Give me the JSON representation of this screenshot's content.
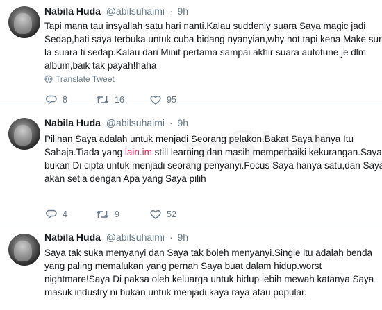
{
  "tweets": [
    {
      "name": "Nabila Huda",
      "handle": "@abilsuhaimi",
      "time": "9h",
      "lines": [
        "Tapi mana tau insyallah satu hari nanti.Kalau suddenly suara Saya magic jadi",
        "Sedap,hati saya terbuka untuk cuba bidang nyanyian,why not.tapi kena Make sure",
        "la suara ti sedap.Kalau dari Minit pertama sampai akhir suara autotune je dlm",
        "album,baik tak payah!haha"
      ],
      "translate": "Translate Tweet",
      "replies": "8",
      "retweets": "16",
      "likes": "95"
    },
    {
      "name": "Nabila Huda",
      "handle": "@abilsuhaimi",
      "time": "9h",
      "line1": "Pilihan Saya adalah untuk menjadi Seorang pelakon.Bakat Saya hanya Itu",
      "line2_pre": "Sahaja.Tiada yang ",
      "line2_link": "lain.im",
      "line2_post": " still learning dan masih memperbaiki kekurangan.Saya",
      "line3": "bukan Di cipta untuk menjadi seorang penyanyi.Focus Saya hanya satu,dan Saya",
      "line4": "akan setia dengan Apa yang Saya pilih",
      "replies": "4",
      "retweets": "9",
      "likes": "52"
    },
    {
      "name": "Nabila Huda",
      "handle": "@abilsuhaimi",
      "time": "9h",
      "lines": [
        "Saya tak suka menyanyi dan Saya tak boleh menyanyi.Single itu adalah benda",
        "yang paling memalukan yang pernah Saya buat dalam hidup.worst",
        "nightmare!Saya Di paksa oleh keluarga untuk hidup lebih mewah katanya.Saya",
        "masuk industry ni bukan untuk menjadi kaya raya atau popular."
      ]
    }
  ],
  "colors": {
    "link": "#e0245e",
    "muted": "#657786",
    "text": "#14171a",
    "divider": "#e6ecf0"
  },
  "icons": [
    "globe-icon",
    "reply-icon",
    "retweet-icon",
    "heart-icon"
  ],
  "watermark": "mStar"
}
